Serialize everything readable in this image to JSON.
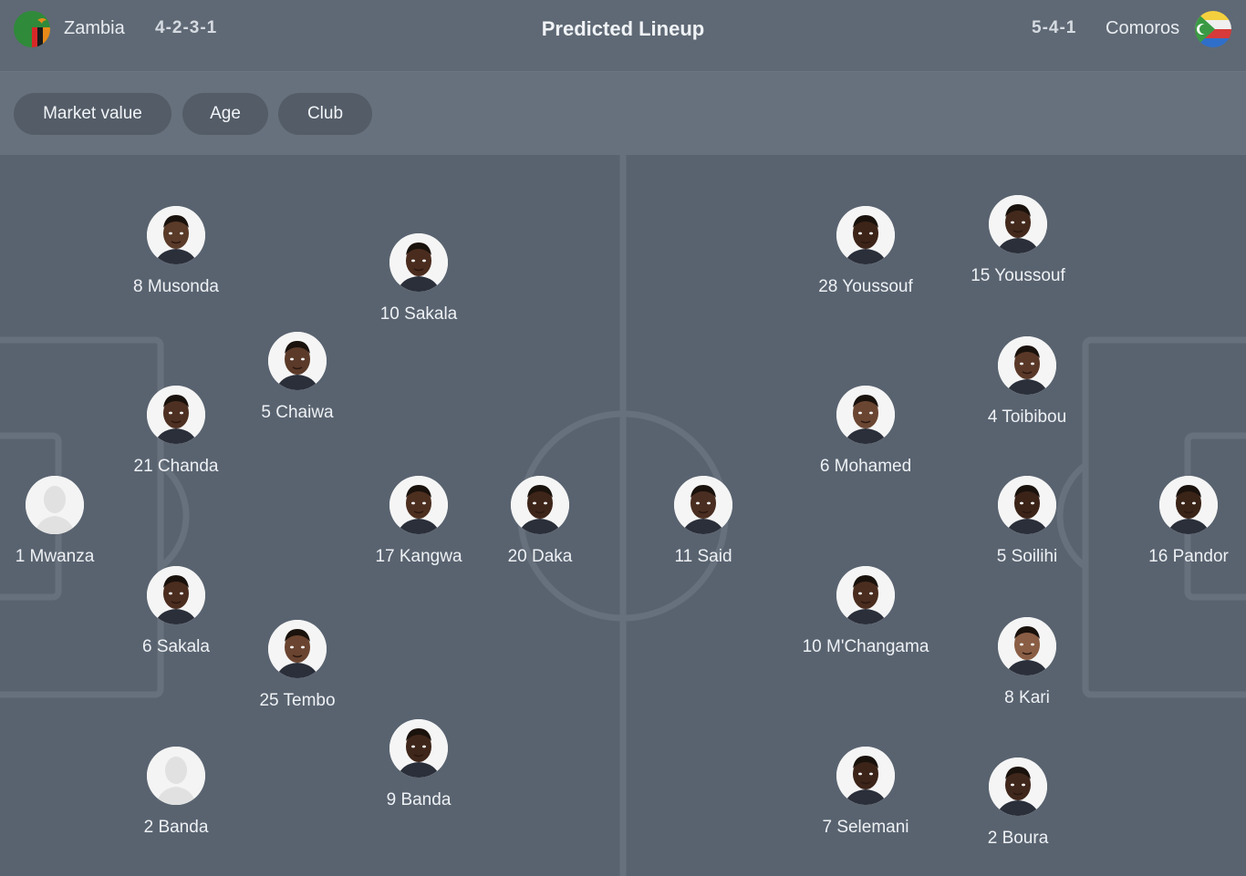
{
  "header": {
    "title": "Predicted Lineup",
    "home": {
      "name": "Zambia",
      "formation": "4-2-3-1",
      "flag_icon": "zambia-flag-icon"
    },
    "away": {
      "name": "Comoros",
      "formation": "5-4-1",
      "flag_icon": "comoros-flag-icon"
    }
  },
  "filters": [
    "Market value",
    "Age",
    "Club"
  ],
  "home_players": [
    {
      "label": "8 Musonda",
      "skin": "#5a3a28"
    },
    {
      "label": "10 Sakala",
      "skin": "#4a2c1e"
    },
    {
      "label": "5 Chaiwa",
      "skin": "#5b3a29"
    },
    {
      "label": "21 Chanda",
      "skin": "#4e3022"
    },
    {
      "label": "1 Mwanza",
      "skin": "placeholder"
    },
    {
      "label": "17 Kangwa",
      "skin": "#4d2f20"
    },
    {
      "label": "20 Daka",
      "skin": "#3e2519"
    },
    {
      "label": "6 Sakala",
      "skin": "#4b2d1f"
    },
    {
      "label": "25 Tembo",
      "skin": "#6a4430"
    },
    {
      "label": "9 Banda",
      "skin": "#3f261a"
    },
    {
      "label": "2 Banda",
      "skin": "placeholder"
    }
  ],
  "away_players": [
    {
      "label": "11 Said",
      "skin": "#4a2e21"
    },
    {
      "label": "28 Youssouf",
      "skin": "#3d2418"
    },
    {
      "label": "15 Youssouf",
      "skin": "#43291c"
    },
    {
      "label": "4 Toibibou",
      "skin": "#5a3828"
    },
    {
      "label": "6 Mohamed",
      "skin": "#6a4632"
    },
    {
      "label": "5 Soilihi",
      "skin": "#3b2318"
    },
    {
      "label": "16 Pandor",
      "skin": "#3a2317"
    },
    {
      "label": "10 M'Changama",
      "skin": "#4a2d1f"
    },
    {
      "label": "8 Kari",
      "skin": "#8a5e45"
    },
    {
      "label": "7 Selemani",
      "skin": "#3c2419"
    },
    {
      "label": "2 Boura",
      "skin": "#40271b"
    }
  ],
  "colors": {
    "pitch": "#596370",
    "lines": "#67717d",
    "pill": "#535c67"
  }
}
